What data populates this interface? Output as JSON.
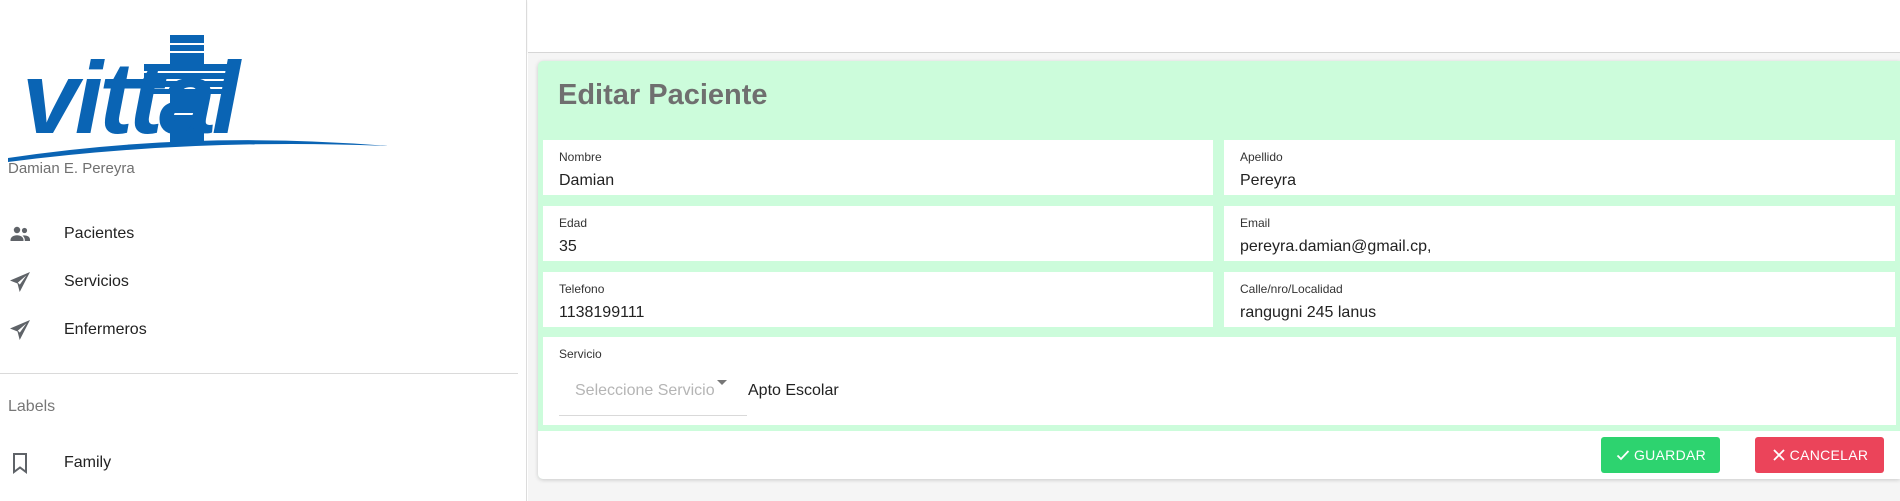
{
  "sidebar": {
    "logo_text": "vittal",
    "user_name": "Damian E. Pereyra",
    "nav": [
      {
        "label": "Pacientes",
        "icon": "people-icon"
      },
      {
        "label": "Servicios",
        "icon": "paper-plane-icon"
      },
      {
        "label": "Enfermeros",
        "icon": "paper-plane-icon"
      }
    ],
    "labels_heading": "Labels",
    "labels": [
      {
        "label": "Family",
        "icon": "bookmark-icon"
      }
    ]
  },
  "form": {
    "title": "Editar Paciente",
    "fields": {
      "nombre": {
        "label": "Nombre",
        "value": "Damian"
      },
      "apellido": {
        "label": "Apellido",
        "value": "Pereyra"
      },
      "edad": {
        "label": "Edad",
        "value": "35"
      },
      "email": {
        "label": "Email",
        "value": "pereyra.damian@gmail.cp,"
      },
      "telefono": {
        "label": "Telefono",
        "value": "1138199111"
      },
      "direccion": {
        "label": "Calle/nro/Localidad",
        "value": "rangugni 245 lanus"
      }
    },
    "servicio": {
      "label": "Servicio",
      "placeholder": "Seleccione Servicio",
      "selected": "Apto Escolar"
    },
    "buttons": {
      "save": "GUARDAR",
      "cancel": "CANCELAR"
    }
  },
  "colors": {
    "card_bg": "#ccfcdb",
    "logo_blue": "#0a64b4",
    "save": "#2dd36f",
    "cancel": "#eb445a"
  }
}
